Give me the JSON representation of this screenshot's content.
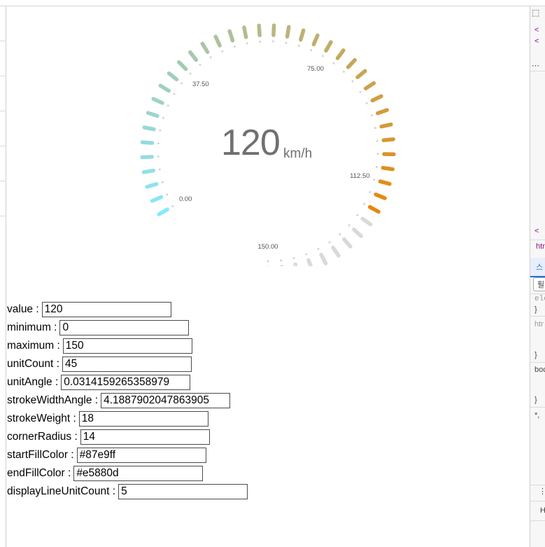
{
  "gauge": {
    "value": "120",
    "unit": "km/h",
    "min": 0,
    "max": 150,
    "unit_count": 45,
    "display_line_unit_count": 5,
    "start_fill_color": "#87e9ff",
    "end_fill_color": "#e5880d",
    "empty_color": "#d9d9d9",
    "tick_labels": [
      "0.00",
      "37.50",
      "75.00",
      "112.50",
      "150.00"
    ]
  },
  "form": {
    "fields": [
      {
        "label": "value :",
        "value": "120"
      },
      {
        "label": "minimum :",
        "value": "0"
      },
      {
        "label": "maximum :",
        "value": "150"
      },
      {
        "label": "unitCount :",
        "value": "45"
      },
      {
        "label": "unitAngle :",
        "value": "0.0314159265358979"
      },
      {
        "label": "strokeWidthAngle :",
        "value": "4.1887902047863905"
      },
      {
        "label": "strokeWeight :",
        "value": "18"
      },
      {
        "label": "cornerRadius :",
        "value": "14"
      },
      {
        "label": "startFillColor :",
        "value": "#87e9ff"
      },
      {
        "label": "endFillColor :",
        "value": "#e5880d"
      },
      {
        "label": "displayLineUnitCount :",
        "value": "5"
      }
    ]
  },
  "devtools": {
    "fragments": [
      "<",
      "<",
      "⋯",
      "<",
      "htr",
      "스",
      "필",
      "ele",
      "}",
      "htr",
      "}",
      "boc",
      "}",
      "*,",
      "⋮",
      "H"
    ]
  }
}
